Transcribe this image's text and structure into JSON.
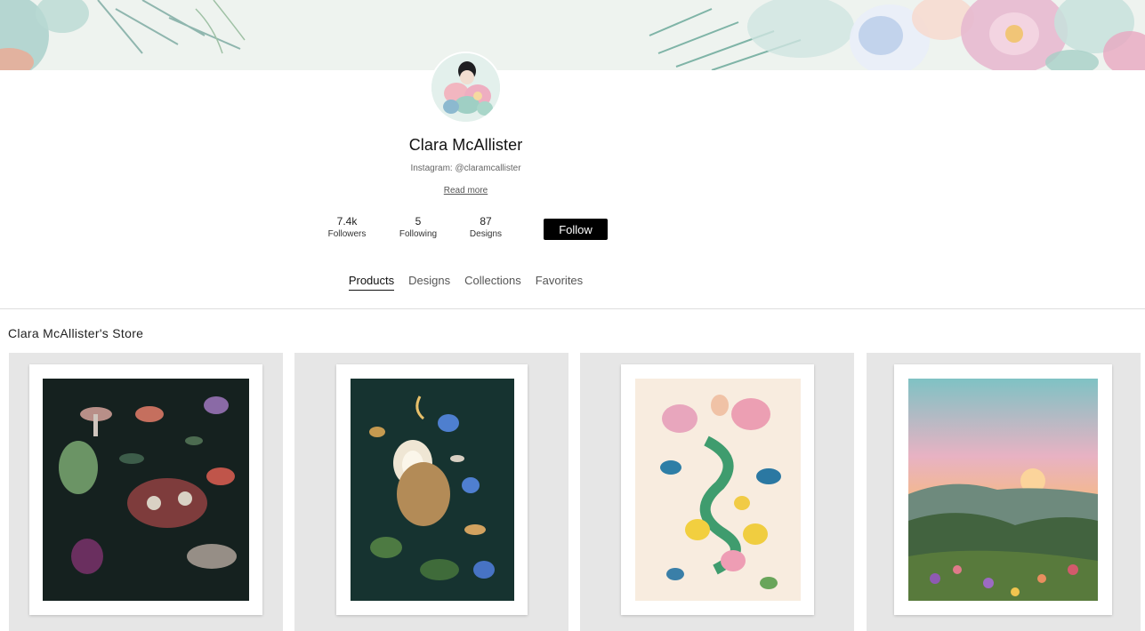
{
  "profile": {
    "name": "Clara McAllister",
    "bio": "Instagram: @claramcallister",
    "read_more": "Read more",
    "follow_label": "Follow"
  },
  "stats": [
    {
      "value": "7.4k",
      "label": "Followers"
    },
    {
      "value": "5",
      "label": "Following"
    },
    {
      "value": "87",
      "label": "Designs"
    }
  ],
  "tabs": [
    {
      "label": "Products",
      "active": true
    },
    {
      "label": "Designs",
      "active": false
    },
    {
      "label": "Collections",
      "active": false
    },
    {
      "label": "Favorites",
      "active": false
    }
  ],
  "store": {
    "title": "Clara McAllister's Store"
  },
  "colors": {
    "accent": "#000000",
    "banner_bg": "#eef3ef"
  }
}
